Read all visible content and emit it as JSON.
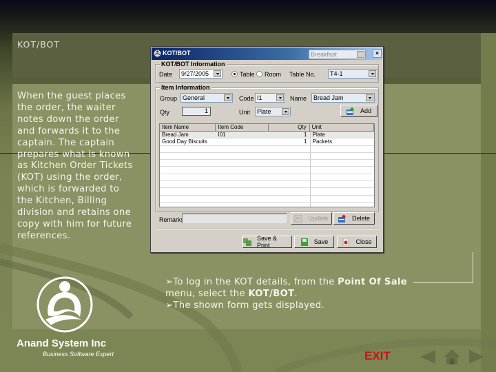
{
  "slide": {
    "title": "KOT/BOT",
    "description": "When the guest places the order, the waiter notes down the order and forwards it to the captain. The captain prepares what is known as Kitchen Order Tickets (KOT) using the order, which is forwarded to the Kitchen, Billing division and retains one copy with him for future references.",
    "bullets": [
      {
        "prefix": "➢To log in the KOT details, from the ",
        "bold1": "Point Of Sale",
        "mid": " menu, select the ",
        "bold2": "KOT/BOT",
        "suffix": "."
      },
      {
        "text": "➢The shown form gets displayed."
      }
    ]
  },
  "branding": {
    "company": "Anand System Inc",
    "tagline": "Business Software Expert",
    "logo_icon": "person-circle-logo-icon"
  },
  "navigation": {
    "exit_label": "EXIT",
    "prev_icon": "arrow-left-icon",
    "home_icon": "home-icon",
    "next_icon": "arrow-right-icon"
  },
  "dialog": {
    "title": "KOT/BOT",
    "meal_selector": "Breakfast",
    "close_label": "×",
    "kot_group": {
      "legend": "KOT/BOT Information",
      "date_label": "Date",
      "date_value": "9/27/2005",
      "radio_table": "Table",
      "radio_room": "Room",
      "selected": "Table",
      "table_no_label": "Table No.",
      "table_no_value": "T4-1"
    },
    "item_group": {
      "legend": "Item Information",
      "group_label": "Group",
      "group_value": "General",
      "code_label": "Code",
      "code_value": "I1",
      "name_label": "Name",
      "name_value": "Bread Jam",
      "qty_label": "Qty",
      "qty_value": "1",
      "unit_label": "Unit",
      "unit_value": "Plate",
      "add_label": "Add"
    },
    "grid": {
      "columns": [
        "Item Name",
        "Item Code",
        "Qty",
        "Unit"
      ],
      "rows": [
        [
          "Bread Jam",
          "I01",
          "1",
          "Plate"
        ],
        [
          "Good Day Biscuits",
          "",
          "1",
          "Packets"
        ]
      ]
    },
    "remarks_label": "Remarks",
    "remarks_value": "",
    "update_label": "Update",
    "delete_label": "Delete",
    "save_print_label": "Save & Print",
    "save_label": "Save",
    "close_button_label": "Close"
  }
}
